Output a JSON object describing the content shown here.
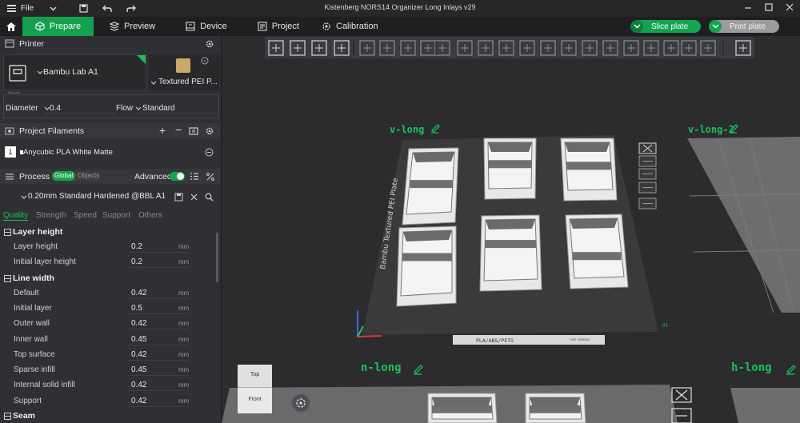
{
  "titlebar": {
    "file_label": "File",
    "title": "Kistenberg NORS14 Organizer Long Inlays v29"
  },
  "toolbar": {
    "tabs": [
      {
        "label": "Prepare",
        "icon": "cube-icon"
      },
      {
        "label": "Preview",
        "icon": "preview-icon"
      },
      {
        "label": "Device",
        "icon": "device-icon"
      },
      {
        "label": "Project",
        "icon": "project-icon"
      },
      {
        "label": "Calibration",
        "icon": "calibration-icon"
      }
    ],
    "slice_label": "Slice plate",
    "print_label": "Print plate"
  },
  "printer": {
    "section_label": "Printer",
    "name": "Bambu Lab A1",
    "plate": "Textured PEI P...",
    "nozzle_legend": "Nozzle",
    "diameter_label": "Diameter",
    "diameter_value": "0.4",
    "flow_label": "Flow",
    "flow_value": "Standard"
  },
  "filaments": {
    "section_label": "Project Filaments",
    "items": [
      {
        "index": "1",
        "name": "Anycubic PLA White Matte",
        "color": "#ffffff"
      }
    ]
  },
  "process": {
    "section_label": "Process",
    "toggle_global": "Global",
    "toggle_objects": "Objects",
    "advanced_label": "Advanced",
    "preset": "0.20mm Standard Hardened @BBL A1",
    "tabs": [
      "Quality",
      "Strength",
      "Speed",
      "Support",
      "Others"
    ],
    "groups": [
      {
        "title": "Layer height",
        "params": [
          {
            "label": "Layer height",
            "value": "0.2",
            "unit": "mm"
          },
          {
            "label": "Initial layer height",
            "value": "0.2",
            "unit": "mm"
          }
        ]
      },
      {
        "title": "Line width",
        "params": [
          {
            "label": "Default",
            "value": "0.42",
            "unit": "mm"
          },
          {
            "label": "Initial layer",
            "value": "0.5",
            "unit": "mm"
          },
          {
            "label": "Outer wall",
            "value": "0.42",
            "unit": "mm"
          },
          {
            "label": "Inner wall",
            "value": "0.45",
            "unit": "mm"
          },
          {
            "label": "Top surface",
            "value": "0.42",
            "unit": "mm"
          },
          {
            "label": "Sparse infill",
            "value": "0.45",
            "unit": "mm"
          },
          {
            "label": "Internal solid infill",
            "value": "0.42",
            "unit": "mm"
          },
          {
            "label": "Support",
            "value": "0.42",
            "unit": "mm"
          }
        ]
      },
      {
        "title": "Seam",
        "params": []
      }
    ]
  },
  "viewport": {
    "plate_labels": [
      "v-long",
      "v-long-2",
      "n-long",
      "h-long"
    ],
    "bed_text": "Bambu Textured PEI Plate",
    "bed_strip_text": "PLA/ABS/PETG",
    "bed_strip_small": "HOT SURFACE",
    "plate_number": "01",
    "view_top": "Top",
    "view_front": "Front",
    "accent_color": "#15c25a"
  }
}
